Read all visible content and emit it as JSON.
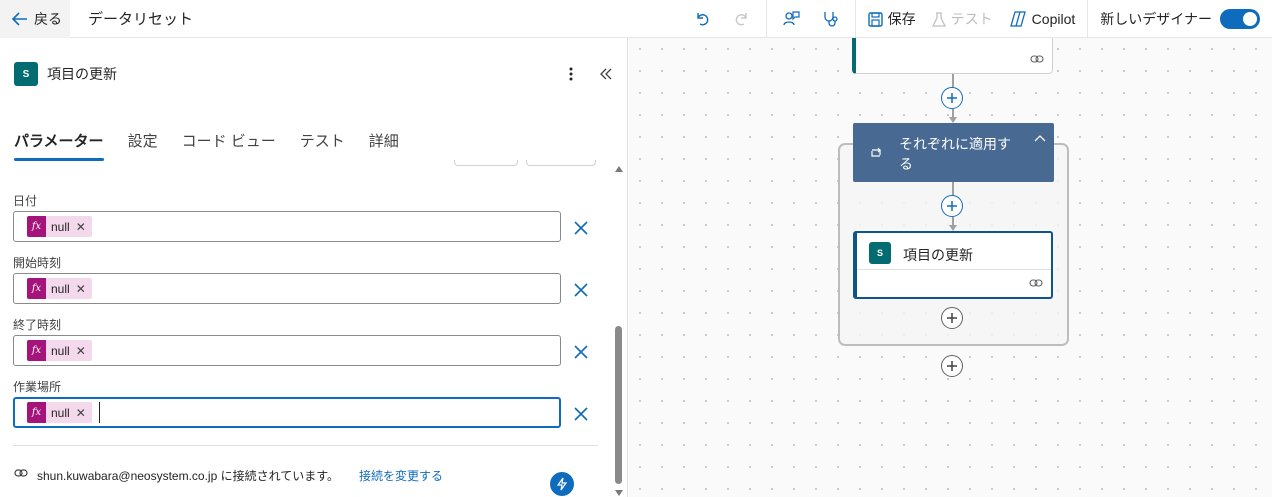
{
  "topbar": {
    "back_label": "戻る",
    "flow_title": "データリセット",
    "save_label": "保存",
    "test_label": "テスト",
    "copilot_label": "Copilot",
    "new_designer_label": "新しいデザイナー",
    "new_designer_on": true
  },
  "panel": {
    "title": "項目の更新",
    "tabs": [
      {
        "label": "パラメーター",
        "active": true
      },
      {
        "label": "設定",
        "active": false
      },
      {
        "label": "コード ビュー",
        "active": false
      },
      {
        "label": "テスト",
        "active": false
      },
      {
        "label": "詳細",
        "active": false
      }
    ],
    "fields": [
      {
        "label": "日付",
        "token": "null"
      },
      {
        "label": "開始時刻",
        "token": "null"
      },
      {
        "label": "終了時刻",
        "token": "null"
      },
      {
        "label": "作業場所",
        "token": "null"
      }
    ],
    "token_fx": "fx",
    "connection_text": "shun.kuwabara@neosystem.co.jp に接続されています。",
    "change_connection": "接続を変更する"
  },
  "canvas": {
    "foreach_title": "それぞれに適用する",
    "update_card_title": "項目の更新",
    "sp_icon_text": "S"
  },
  "colors": {
    "accent": "#0f6cbd",
    "sharepoint": "#036c70",
    "foreach_header": "#486991",
    "token_bg": "#f4d9ec",
    "fx_bg": "#a4147a"
  }
}
